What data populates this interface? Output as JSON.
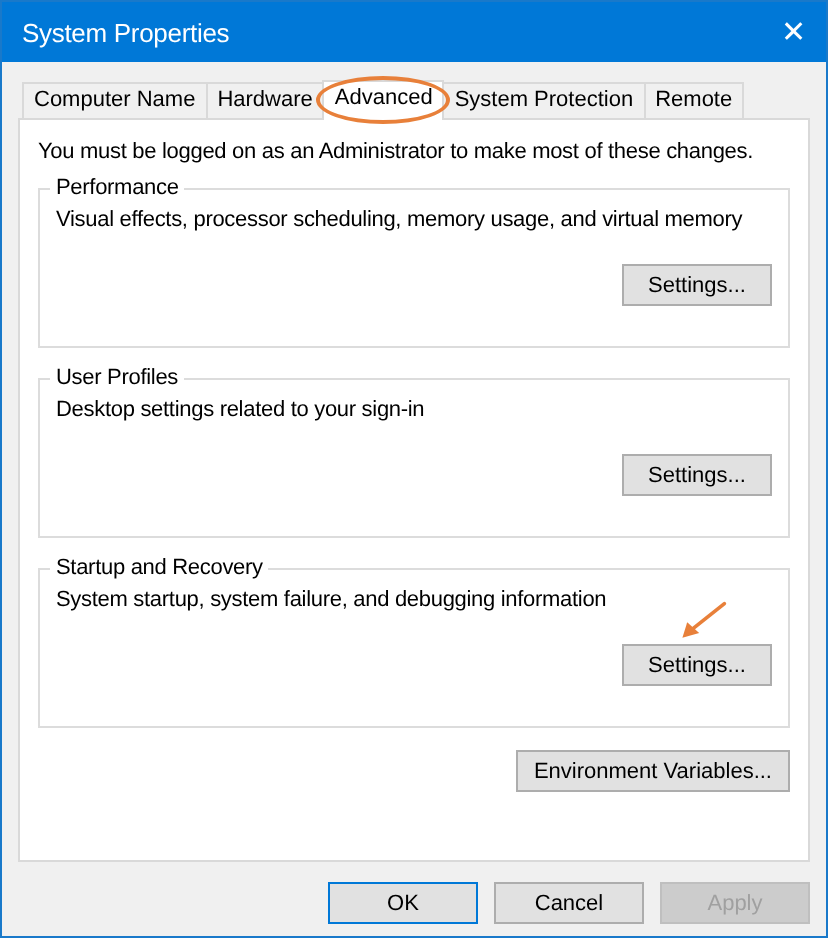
{
  "window": {
    "title": "System Properties",
    "close": "✕"
  },
  "tabs": [
    {
      "label": "Computer Name",
      "selected": false,
      "circled": false
    },
    {
      "label": "Hardware",
      "selected": false,
      "circled": false
    },
    {
      "label": "Advanced",
      "selected": true,
      "circled": true
    },
    {
      "label": "System Protection",
      "selected": false,
      "circled": false
    },
    {
      "label": "Remote",
      "selected": false,
      "circled": false
    }
  ],
  "notice": "You must be logged on as an Administrator to make most of these changes.",
  "groups": [
    {
      "title": "Performance",
      "description": "Visual effects, processor scheduling, memory usage, and virtual memory",
      "button": "Settings...",
      "arrow": false
    },
    {
      "title": "User Profiles",
      "description": "Desktop settings related to your sign-in",
      "button": "Settings...",
      "arrow": false
    },
    {
      "title": "Startup and Recovery",
      "description": "System startup, system failure, and debugging information",
      "button": "Settings...",
      "arrow": true
    }
  ],
  "environment_button": "Environment Variables...",
  "buttons": [
    {
      "label": "OK",
      "disabled": false
    },
    {
      "label": "Cancel",
      "disabled": false
    },
    {
      "label": "Apply",
      "disabled": true
    }
  ]
}
